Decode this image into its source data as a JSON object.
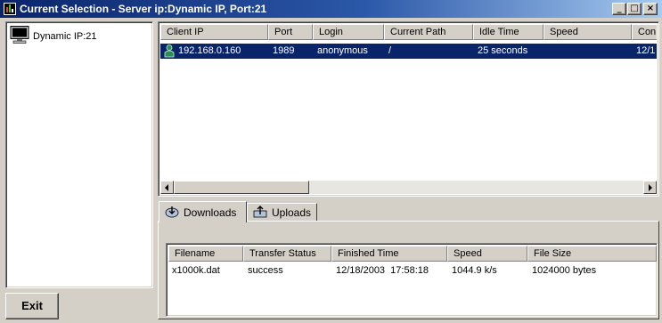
{
  "window": {
    "title": "Current Selection - Server ip:Dynamic IP, Port:21",
    "buttons": {
      "minimize": "_",
      "maximize": "□",
      "close": "×"
    }
  },
  "servers": [
    {
      "label": "Dynamic IP:21",
      "icon": "monitor-icon"
    }
  ],
  "clients": {
    "columns": [
      "Client IP",
      "Port",
      "Login",
      "Current Path",
      "Idle Time",
      "Speed",
      "Con"
    ],
    "rows": [
      {
        "client_ip": "192.168.0.160",
        "port": "1989",
        "login": "anonymous",
        "current_path": "/",
        "idle_time": "25 seconds",
        "speed": "",
        "con": "12/1",
        "icon": "user-icon",
        "selected": true
      }
    ]
  },
  "tabs": [
    {
      "label": "Downloads",
      "icon": "downloads-icon",
      "active": true
    },
    {
      "label": "Uploads",
      "icon": "uploads-icon",
      "active": false
    }
  ],
  "transfers": {
    "columns": [
      "Filename",
      "Transfer Status",
      "Finished Time",
      "Speed",
      "File Size"
    ],
    "rows": [
      {
        "filename": "x1000k.dat",
        "status": "success",
        "finished_time": "12/18/2003  17:58:18",
        "speed": "1044.9 k/s",
        "file_size": "1024000 bytes"
      }
    ]
  },
  "exit_button": {
    "label": "Exit"
  },
  "colors": {
    "selection": "#0a246a",
    "title_start": "#0a246a",
    "title_end": "#a6caf0",
    "face": "#d4d0c8"
  }
}
